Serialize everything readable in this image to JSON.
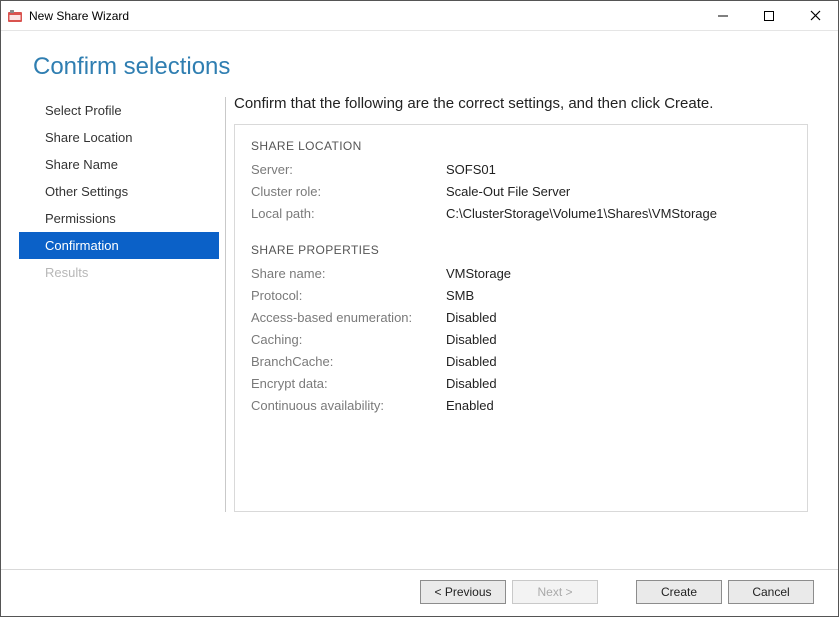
{
  "window": {
    "title": "New Share Wizard"
  },
  "page": {
    "title": "Confirm selections",
    "instruction": "Confirm that the following are the correct settings, and then click Create."
  },
  "sidebar": {
    "items": [
      {
        "label": "Select Profile",
        "state": "done"
      },
      {
        "label": "Share Location",
        "state": "done"
      },
      {
        "label": "Share Name",
        "state": "done"
      },
      {
        "label": "Other Settings",
        "state": "done"
      },
      {
        "label": "Permissions",
        "state": "done"
      },
      {
        "label": "Confirmation",
        "state": "active"
      },
      {
        "label": "Results",
        "state": "disabled"
      }
    ]
  },
  "sections": {
    "location": {
      "heading": "SHARE LOCATION",
      "server_label": "Server:",
      "server_value": "SOFS01",
      "cluster_label": "Cluster role:",
      "cluster_value": "Scale-Out File Server",
      "path_label": "Local path:",
      "path_value": "C:\\ClusterStorage\\Volume1\\Shares\\VMStorage"
    },
    "properties": {
      "heading": "SHARE PROPERTIES",
      "name_label": "Share name:",
      "name_value": "VMStorage",
      "protocol_label": "Protocol:",
      "protocol_value": "SMB",
      "abe_label": "Access-based enumeration:",
      "abe_value": "Disabled",
      "cache_label": "Caching:",
      "cache_value": "Disabled",
      "branch_label": "BranchCache:",
      "branch_value": "Disabled",
      "encrypt_label": "Encrypt data:",
      "encrypt_value": "Disabled",
      "ca_label": "Continuous availability:",
      "ca_value": "Enabled"
    }
  },
  "buttons": {
    "previous": "< Previous",
    "next": "Next >",
    "create": "Create",
    "cancel": "Cancel"
  }
}
